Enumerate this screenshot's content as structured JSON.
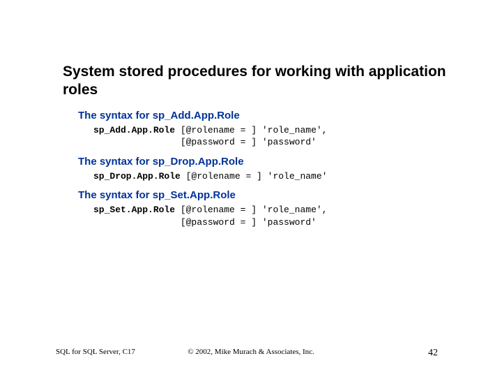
{
  "title": "System stored procedures for working with application roles",
  "sections": [
    {
      "heading": "The syntax for sp_Add.App.Role",
      "code_bold": "sp_Add.App.Role",
      "code_rest": " [@rolename = ] 'role_name',\n                [@password = ] 'password'"
    },
    {
      "heading": "The syntax for sp_Drop.App.Role",
      "code_bold": "sp_Drop.App.Role",
      "code_rest": " [@rolename = ] 'role_name'"
    },
    {
      "heading": "The syntax for sp_Set.App.Role",
      "code_bold": "sp_Set.App.Role",
      "code_rest": " [@rolename = ] 'role_name',\n                [@password = ] 'password'"
    }
  ],
  "footer": {
    "left": "SQL for SQL Server, C17",
    "center": "© 2002, Mike Murach & Associates, Inc.",
    "right": "42"
  }
}
